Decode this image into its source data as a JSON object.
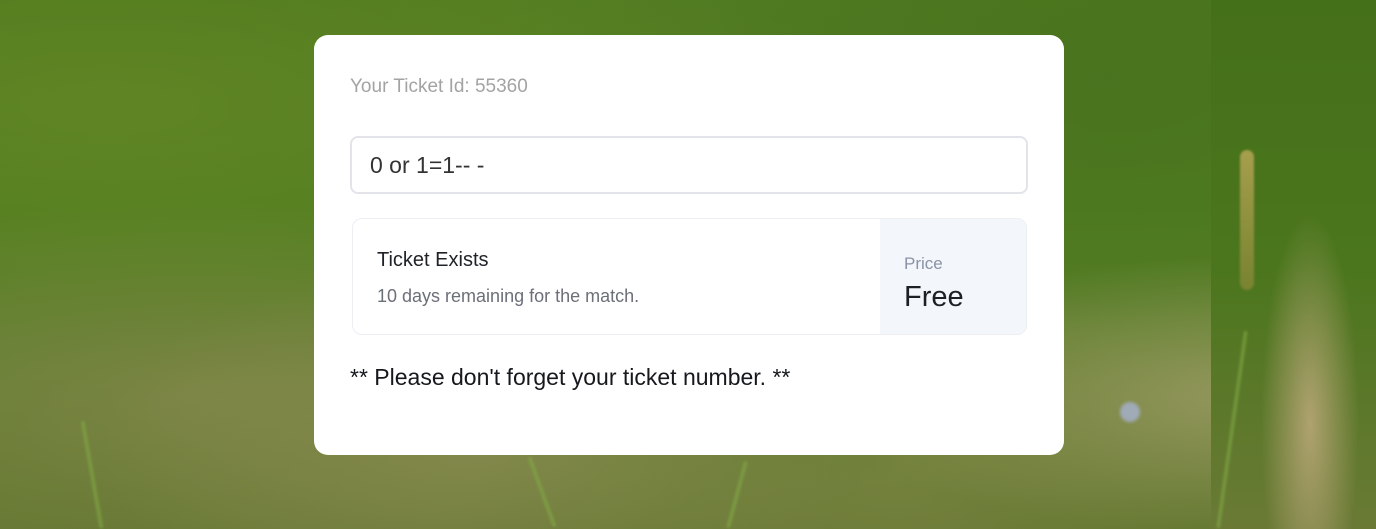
{
  "ticket": {
    "id_label": "Your Ticket Id: 55360",
    "input_value": "0 or 1=1-- -"
  },
  "result": {
    "title": "Ticket Exists",
    "subtitle": "10 days remaining for the match.",
    "price_label": "Price",
    "price_value": "Free"
  },
  "notice": "** Please don't forget your ticket number. **",
  "colors": {
    "card_background": "#ffffff",
    "price_panel": "#f3f6fb",
    "background_grass": "#4f7d20"
  }
}
